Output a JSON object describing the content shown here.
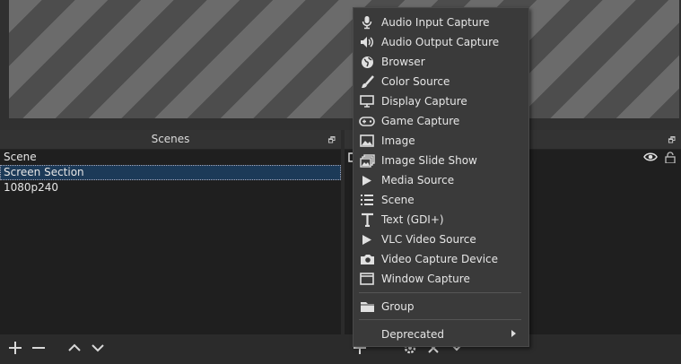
{
  "scenes": {
    "title": "Scenes",
    "items": [
      {
        "label": "Scene",
        "selected": false
      },
      {
        "label": "Screen Section",
        "selected": true
      },
      {
        "label": "1080p240",
        "selected": false
      }
    ]
  },
  "context_menu": {
    "items": [
      {
        "label": "Audio Input Capture",
        "icon": "microphone-icon"
      },
      {
        "label": "Audio Output Capture",
        "icon": "speaker-icon"
      },
      {
        "label": "Browser",
        "icon": "globe-icon"
      },
      {
        "label": "Color Source",
        "icon": "paintbrush-icon"
      },
      {
        "label": "Display Capture",
        "icon": "monitor-icon"
      },
      {
        "label": "Game Capture",
        "icon": "gamepad-icon"
      },
      {
        "label": "Image",
        "icon": "image-icon"
      },
      {
        "label": "Image Slide Show",
        "icon": "slideshow-icon"
      },
      {
        "label": "Media Source",
        "icon": "play-icon"
      },
      {
        "label": "Scene",
        "icon": "list-icon"
      },
      {
        "label": "Text (GDI+)",
        "icon": "text-icon"
      },
      {
        "label": "VLC Video Source",
        "icon": "play-icon"
      },
      {
        "label": "Video Capture Device",
        "icon": "camera-icon"
      },
      {
        "label": "Window Capture",
        "icon": "window-icon"
      }
    ],
    "group_label": "Group",
    "deprecated_label": "Deprecated"
  },
  "colors": {
    "accent_selection": "#1c3a58",
    "menu_bg": "#3a3a3a",
    "preview_stripe_light": "#6b6b6b",
    "preview_stripe_dark": "#4d4d4d"
  }
}
